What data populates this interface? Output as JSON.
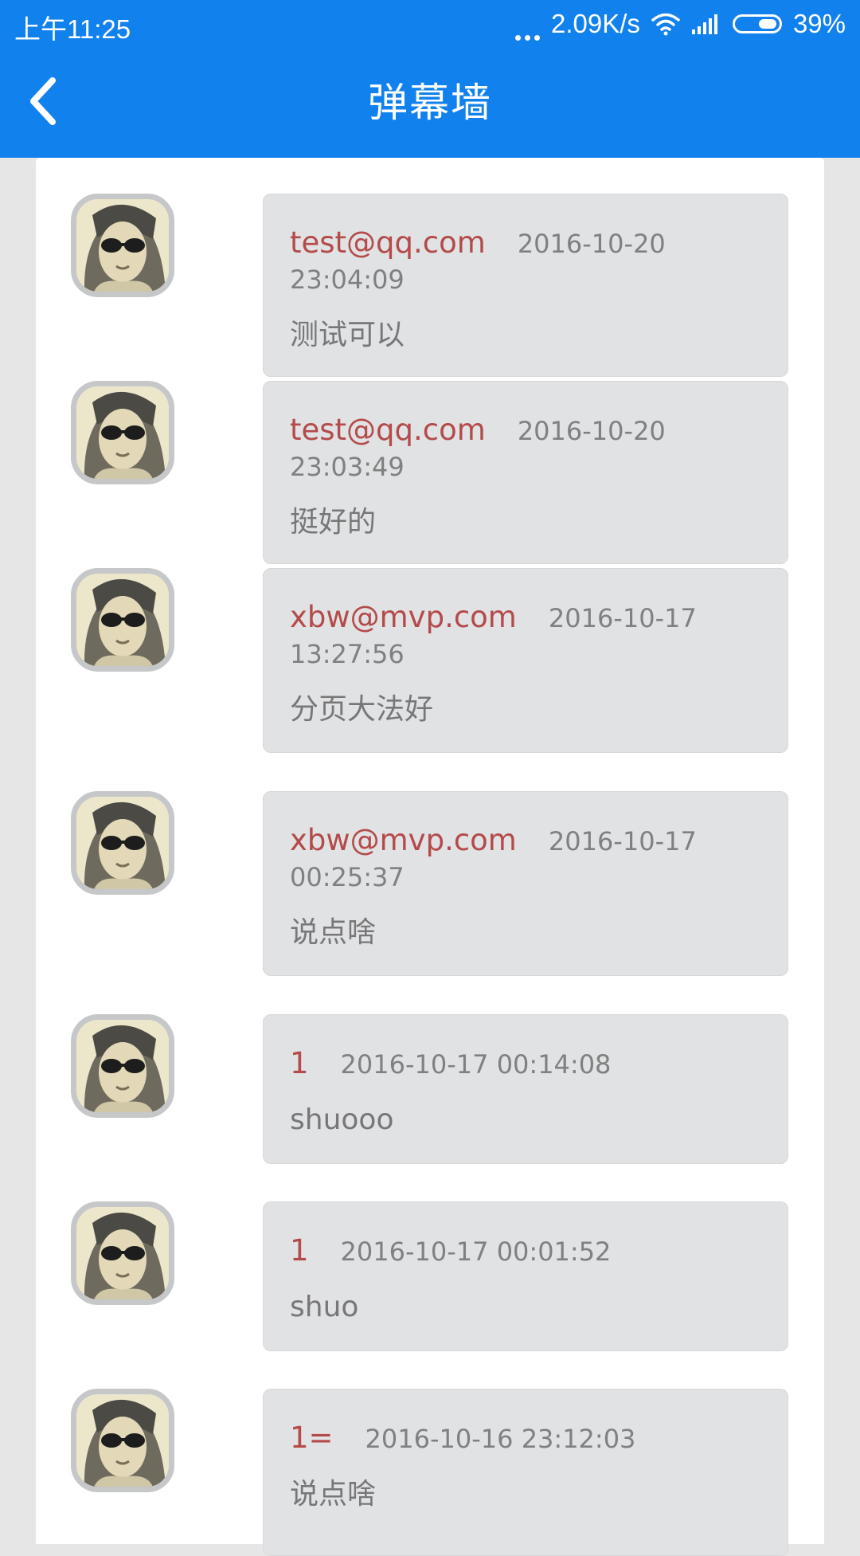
{
  "status_bar": {
    "time": "上午11:25",
    "network_speed": "2.09K/s",
    "battery": "39%",
    "icons": [
      "more-dots-icon",
      "wifi-icon",
      "signal-icon",
      "battery-icon"
    ]
  },
  "header": {
    "title": "弹幕墙",
    "back_icon": "chevron-left-icon"
  },
  "colors": {
    "primary": "#1181ee",
    "author": "#b44a4a",
    "bubble": "#e1e2e4",
    "background": "#e6e6e6"
  },
  "messages": [
    {
      "author": "test@qq.com",
      "time": "2016-10-20 23:04:09",
      "content": "测试可以"
    },
    {
      "author": "test@qq.com",
      "time": "2016-10-20 23:03:49",
      "content": "挺好的"
    },
    {
      "author": "xbw@mvp.com",
      "time": "2016-10-17 13:27:56",
      "content": "分页大法好"
    },
    {
      "author": "xbw@mvp.com",
      "time": "2016-10-17 00:25:37",
      "content": "说点啥"
    },
    {
      "author": "1",
      "time": "2016-10-17 00:14:08",
      "content": "shuooo"
    },
    {
      "author": "1",
      "time": "2016-10-17 00:01:52",
      "content": "shuo"
    },
    {
      "author": "1=",
      "time": "2016-10-16 23:12:03",
      "content": "说点啥"
    }
  ]
}
